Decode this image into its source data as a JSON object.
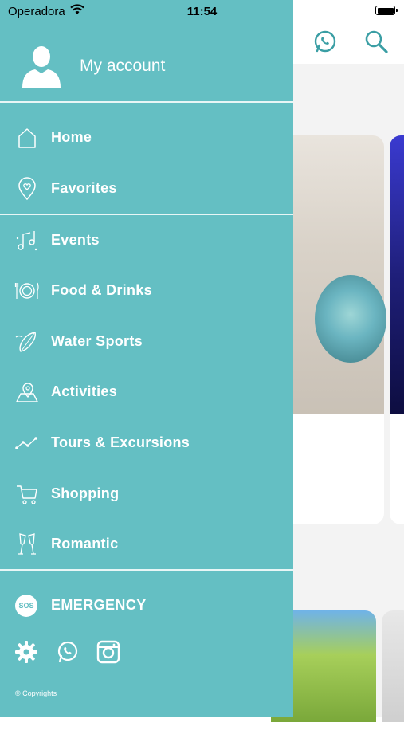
{
  "status_bar": {
    "carrier": "Operadora",
    "time": "11:54"
  },
  "drawer": {
    "account_label": "My account",
    "menu": [
      {
        "label": "Home",
        "icon": "home-icon"
      },
      {
        "label": "Favorites",
        "icon": "heart-pin-icon"
      },
      {
        "label": "Events",
        "icon": "music-notes-icon"
      },
      {
        "label": "Food & Drinks",
        "icon": "plate-cutlery-icon"
      },
      {
        "label": "Water Sports",
        "icon": "surfboard-icon"
      },
      {
        "label": "Activities",
        "icon": "map-pin-icon"
      },
      {
        "label": "Tours & Excursions",
        "icon": "route-icon"
      },
      {
        "label": "Shopping",
        "icon": "cart-icon"
      },
      {
        "label": "Romantic",
        "icon": "champagne-glasses-icon"
      }
    ],
    "emergency": {
      "badge": "SOS",
      "label": "EMERGENCY"
    },
    "bottom_icons": [
      "settings-icon",
      "whatsapp-icon",
      "instagram-icon"
    ],
    "copyright": "© Copyrights"
  },
  "app_header": {
    "icons": [
      "whatsapp-icon",
      "search-icon"
    ]
  },
  "colors": {
    "drawer_bg": "#64bfc3",
    "accent": "#3a9ea4",
    "text": "#ffffff"
  }
}
